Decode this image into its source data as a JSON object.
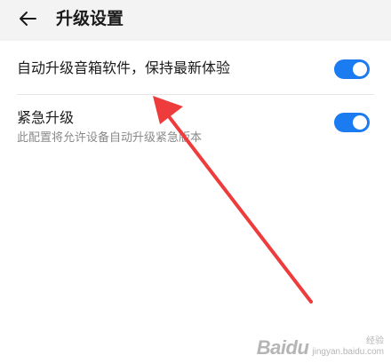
{
  "header": {
    "title": "升级设置",
    "back_icon": "arrow-left-icon"
  },
  "settings": [
    {
      "title": "自动升级音箱软件，保持最新体验",
      "enabled": true
    },
    {
      "title": "紧急升级",
      "description": "此配置将允许设备自动升级紧急版本",
      "enabled": true
    }
  ],
  "annotation": {
    "arrow_color": "#ee3b3b"
  },
  "watermark": {
    "logo": "Baidu",
    "line1": "经验",
    "line2": "jingyan.baidu.com"
  },
  "colors": {
    "toggle_on": "#1a7cf0",
    "header_bg": "#f3f3f3"
  }
}
